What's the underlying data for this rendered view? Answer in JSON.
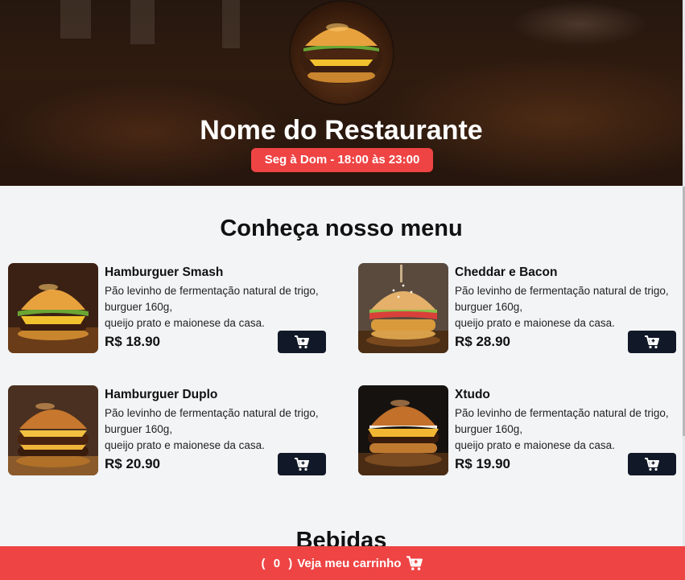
{
  "header": {
    "title": "Nome do Restaurante",
    "hours": "Seg à Dom - 18:00 às 23:00"
  },
  "menu": {
    "heading": "Conheça nosso menu",
    "items": [
      {
        "name": "Hamburguer Smash",
        "desc_lines": [
          "Pão levinho de fermentação natural de trigo,",
          "burguer 160g,",
          "queijo prato e maionese da casa."
        ],
        "price": "R$ 18.90"
      },
      {
        "name": "Cheddar e Bacon",
        "desc_lines": [
          "Pão levinho de fermentação natural de trigo,",
          "burguer 160g,",
          "queijo prato e maionese da casa."
        ],
        "price": "R$ 28.90"
      },
      {
        "name": "Hamburguer Duplo",
        "desc_lines": [
          "Pão levinho de fermentação natural de trigo,",
          "burguer 160g,",
          "queijo prato e maionese da casa."
        ],
        "price": "R$ 20.90"
      },
      {
        "name": "Xtudo",
        "desc_lines": [
          "Pão levinho de fermentação natural de trigo,",
          "burguer 160g,",
          "queijo prato e maionese da casa."
        ],
        "price": "R$ 19.90"
      }
    ]
  },
  "drinks": {
    "heading": "Bebidas"
  },
  "cart": {
    "count": "0",
    "label": "Veja meu carrinho"
  },
  "colors": {
    "accent": "#ef4444",
    "button_dark": "#111827",
    "page_bg": "#f3f4f6"
  },
  "icons": {
    "add_to_cart": "cart-plus-icon",
    "footer_cart": "cart-plus-icon"
  }
}
